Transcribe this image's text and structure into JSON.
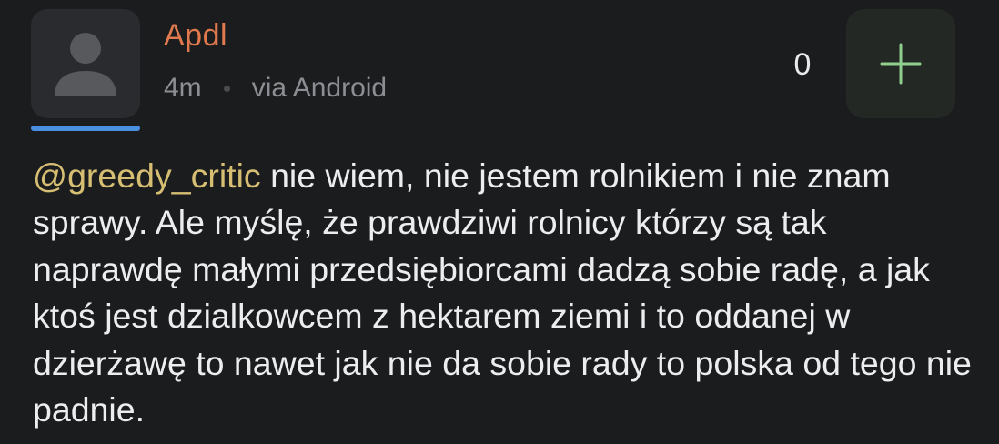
{
  "comment": {
    "author": "Apdl",
    "time": "4m",
    "source": "via Android",
    "score": "0",
    "mention": "@greedy_critic",
    "body": " nie wiem, nie jestem rolnikiem i nie znam sprawy. Ale myślę, że prawdziwi rolnicy którzy są tak naprawdę małymi przedsiębiorcami dadzą sobie radę, a jak ktoś jest dzialkowcem z hektarem ziemi i to oddanej w dzierżawę to nawet jak nie da sobie rady to polska od tego nie padnie."
  },
  "colors": {
    "background": "#1b1c1e",
    "author": "#e07a4e",
    "mention": "#d6be73",
    "meta": "#8c8e93",
    "avatar_underline": "#4a8fe0",
    "upvote_plus": "#8fce8c"
  },
  "icons": {
    "avatar": "default-user-icon",
    "upvote": "plus-icon"
  }
}
